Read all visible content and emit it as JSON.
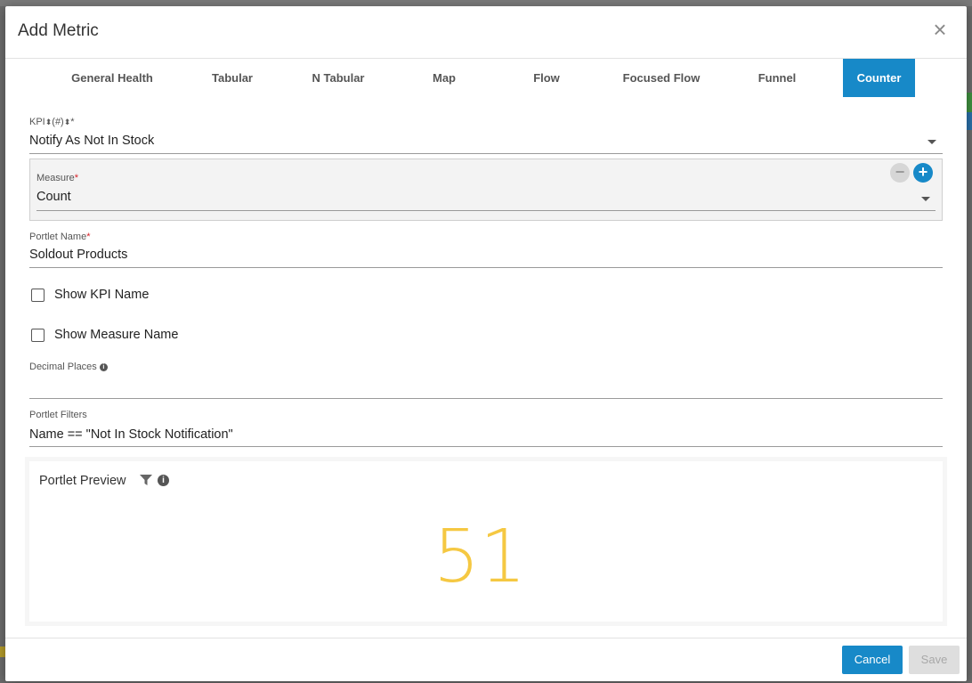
{
  "dialog": {
    "title": "Add Metric",
    "close_icon": "close-icon"
  },
  "tabs": [
    {
      "label": "General Health",
      "active": false
    },
    {
      "label": "Tabular",
      "active": false
    },
    {
      "label": "N Tabular",
      "active": false
    },
    {
      "label": "Map",
      "active": false
    },
    {
      "label": "Flow",
      "active": false
    },
    {
      "label": "Focused Flow",
      "active": false
    },
    {
      "label": "Funnel",
      "active": false
    },
    {
      "label": "Counter",
      "active": true
    }
  ],
  "form": {
    "kpi": {
      "label": "KPI",
      "sort_label": "(#)",
      "required_mark": "*",
      "value": "Notify As Not In Stock"
    },
    "measure": {
      "label": "Measure",
      "required_mark": "*",
      "value": "Count"
    },
    "portlet_name": {
      "label": "Portlet Name",
      "required_mark": "*",
      "value": "Soldout Products"
    },
    "show_kpi_name": {
      "label": "Show KPI Name",
      "checked": false
    },
    "show_measure_name": {
      "label": "Show Measure Name",
      "checked": false
    },
    "decimal_places": {
      "label": "Decimal Places",
      "value": ""
    },
    "portlet_filters": {
      "label": "Portlet Filters",
      "value": "Name == \"Not In Stock Notification\""
    }
  },
  "preview": {
    "title": "Portlet Preview",
    "counter_value": "51",
    "counter_color": "#f5c842"
  },
  "footer": {
    "cancel_label": "Cancel",
    "save_label": "Save"
  },
  "colors": {
    "accent": "#1789c8",
    "required": "#d8232a"
  }
}
